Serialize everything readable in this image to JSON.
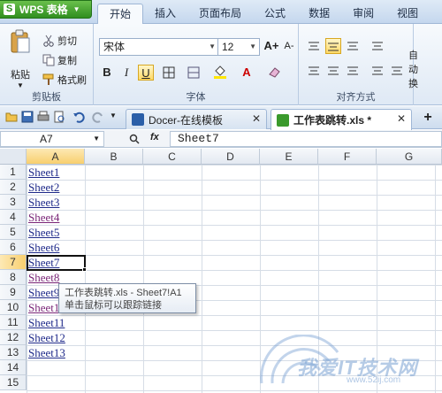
{
  "app": {
    "name": "WPS 表格",
    "logo": "S"
  },
  "menu_tabs": [
    "开始",
    "插入",
    "页面布局",
    "公式",
    "数据",
    "审阅",
    "视图"
  ],
  "active_menu_tab": "开始",
  "ribbon": {
    "clipboard": {
      "paste": "粘贴",
      "cut": "剪切",
      "copy": "复制",
      "format_painter": "格式刷",
      "label": "剪贴板"
    },
    "font": {
      "font_name": "宋体",
      "font_size": "12",
      "bold": "B",
      "italic": "I",
      "underline": "U",
      "grow": "A+",
      "shrink": "A-",
      "label": "字体"
    },
    "alignment": {
      "label": "对齐方式",
      "auto_wrap": "自动换"
    }
  },
  "doc_tabs": [
    {
      "label": "Docer-在线模板",
      "active": false
    },
    {
      "label": "工作表跳转.xls *",
      "active": true
    }
  ],
  "formula_bar": {
    "name_box": "A7",
    "fx": "fx",
    "value": "Sheet7"
  },
  "columns": [
    "A",
    "B",
    "C",
    "D",
    "E",
    "F",
    "G"
  ],
  "rows": [
    "1",
    "2",
    "3",
    "4",
    "5",
    "6",
    "7",
    "8",
    "9",
    "10",
    "11",
    "12",
    "13",
    "14",
    "15"
  ],
  "cells_A": [
    "Sheet1",
    "Sheet2",
    "Sheet3",
    "Sheet4",
    "Sheet5",
    "Sheet6",
    "Sheet7",
    "Sheet8",
    "Sheet9",
    "Sheet10",
    "Sheet11",
    "Sheet12",
    "Sheet13"
  ],
  "visited_rows": [
    4,
    8,
    10
  ],
  "selected_cell": "A7",
  "tooltip": {
    "line1": "工作表跳转.xls - Sheet7!A1",
    "line2": "单击鼠标可以跟踪链接"
  },
  "watermark": {
    "text": "我爱IT技术网",
    "url": "www.52ij.com"
  },
  "colors": {
    "accent_green": "#2f8e1f",
    "link": "#1f2a8a",
    "visited_link": "#7a2678",
    "selected_header": "#f8cf6e"
  }
}
